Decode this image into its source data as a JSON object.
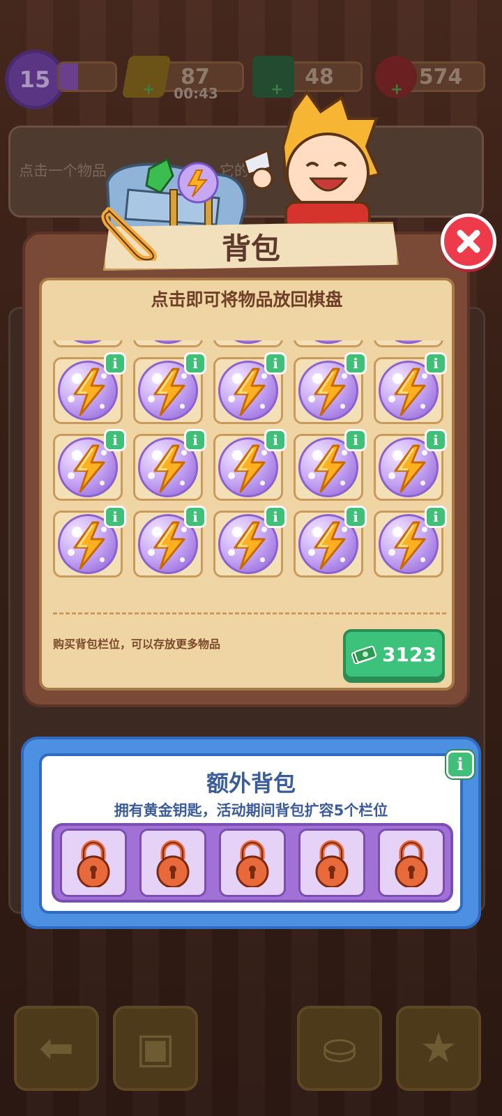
{
  "hud": {
    "level": "15",
    "level_progress": 0.34,
    "energy": "87",
    "energy_timer": "00:43",
    "cash": "48",
    "gems": "574"
  },
  "hint": {
    "text": "点击一个物品",
    "text_tail": "它的"
  },
  "backpack": {
    "title": "背包",
    "subtitle": "点击即可将物品放回棋盘",
    "item_icon": "energy-orb-icon",
    "visible_rows": 4,
    "columns": 5,
    "buy_text": "购买背包栏位，可以存放更多物品",
    "buy_price": "3123"
  },
  "extra_backpack": {
    "title": "额外背包",
    "subtitle": "拥有黄金钥匙，活动期间背包扩容5个栏位",
    "locked_slots": 5
  },
  "colors": {
    "accent_green": "#3cc27a",
    "close_red": "#ee3b4b",
    "panel_blue": "#4d8fe0",
    "locked_purple": "#a171d6"
  }
}
